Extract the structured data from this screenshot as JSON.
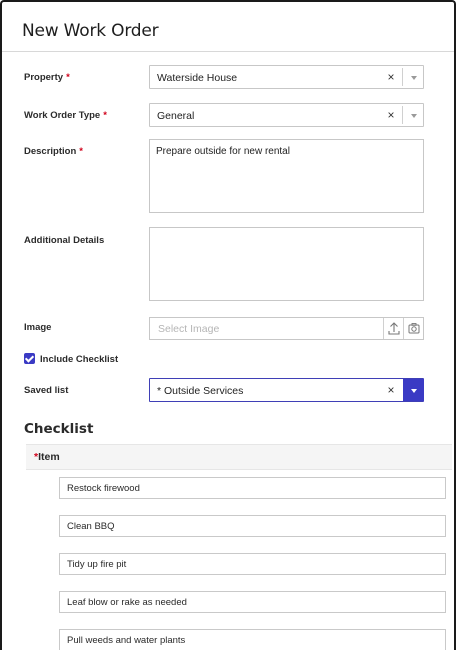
{
  "dialog": {
    "title": "New Work Order"
  },
  "form": {
    "required_marker": "*",
    "property": {
      "label": "Property",
      "value": "Waterside House",
      "clear": "×"
    },
    "work_order_type": {
      "label": "Work Order Type",
      "value": "General",
      "clear": "×"
    },
    "description": {
      "label": "Description",
      "value": "Prepare outside for new rental"
    },
    "additional_details": {
      "label": "Additional Details",
      "value": ""
    },
    "image": {
      "label": "Image",
      "placeholder": "Select Image"
    },
    "include_checklist": {
      "label": "Include Checklist",
      "checked": true
    },
    "saved_list": {
      "label": "Saved list",
      "value": "* Outside Services",
      "clear": "×"
    }
  },
  "checklist": {
    "title": "Checklist",
    "column_header": "Item",
    "items": [
      "Restock firewood",
      "Clean BBQ",
      "Tidy up fire pit",
      "Leaf blow or rake as needed",
      "Pull weeds and water plants"
    ]
  },
  "colors": {
    "accent": "#3a3ac4",
    "required": "#d0021b"
  },
  "icons": {
    "upload": "upload-icon",
    "camera": "camera-icon",
    "dropdown": "chevron-down-icon"
  }
}
